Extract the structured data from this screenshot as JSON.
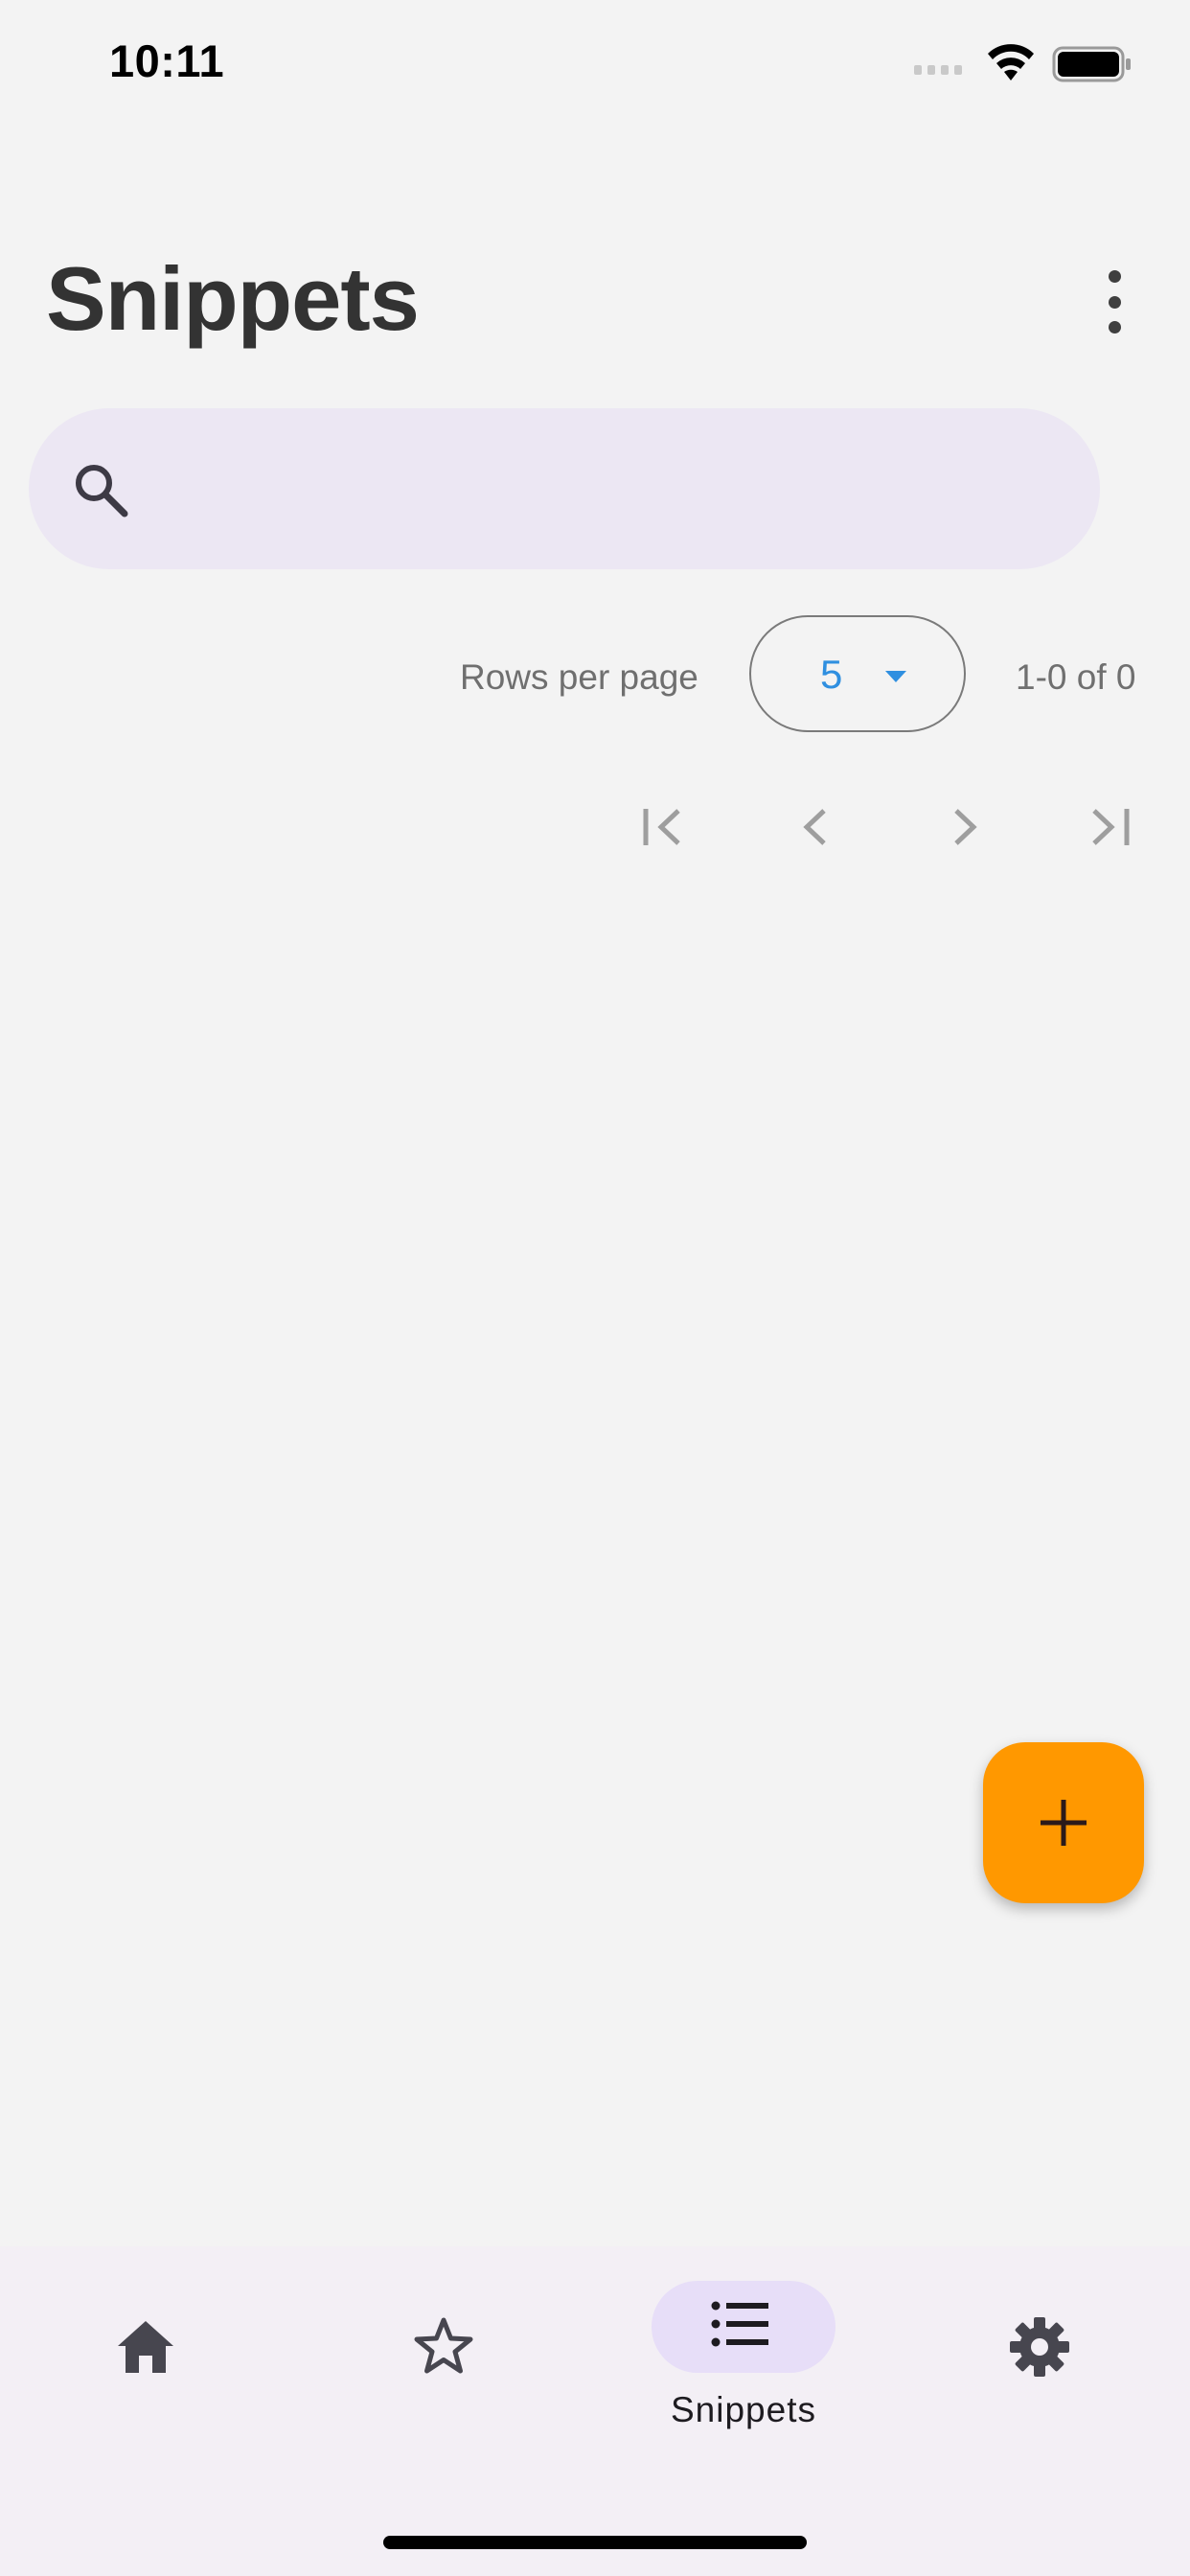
{
  "status_bar": {
    "time": "10:11",
    "icons": [
      "signal-icon",
      "wifi-icon",
      "battery-icon"
    ]
  },
  "header": {
    "title": "Snippets",
    "menu_icon": "more-vert-icon"
  },
  "search": {
    "icon": "search-icon",
    "placeholder": "",
    "value": ""
  },
  "pagination": {
    "rows_label": "Rows per page",
    "rows_value": "5",
    "range_text": "1-0 of 0",
    "buttons": [
      "first-page-icon",
      "prev-page-icon",
      "next-page-icon",
      "last-page-icon"
    ]
  },
  "fab": {
    "icon": "add-icon",
    "color": "#ff9800"
  },
  "bottom_nav": {
    "items": [
      {
        "icon": "home-icon",
        "label": ""
      },
      {
        "icon": "star-icon",
        "label": ""
      },
      {
        "icon": "list-icon",
        "label": "Snippets",
        "selected": true
      },
      {
        "icon": "gear-icon",
        "label": ""
      }
    ]
  },
  "colors": {
    "background": "#f3f3f3",
    "search_bg": "#ece7f3",
    "accent": "#2f8fe0",
    "fab": "#ff9800",
    "nav_bg": "#f3eff5",
    "nav_pill": "#e7def8"
  }
}
